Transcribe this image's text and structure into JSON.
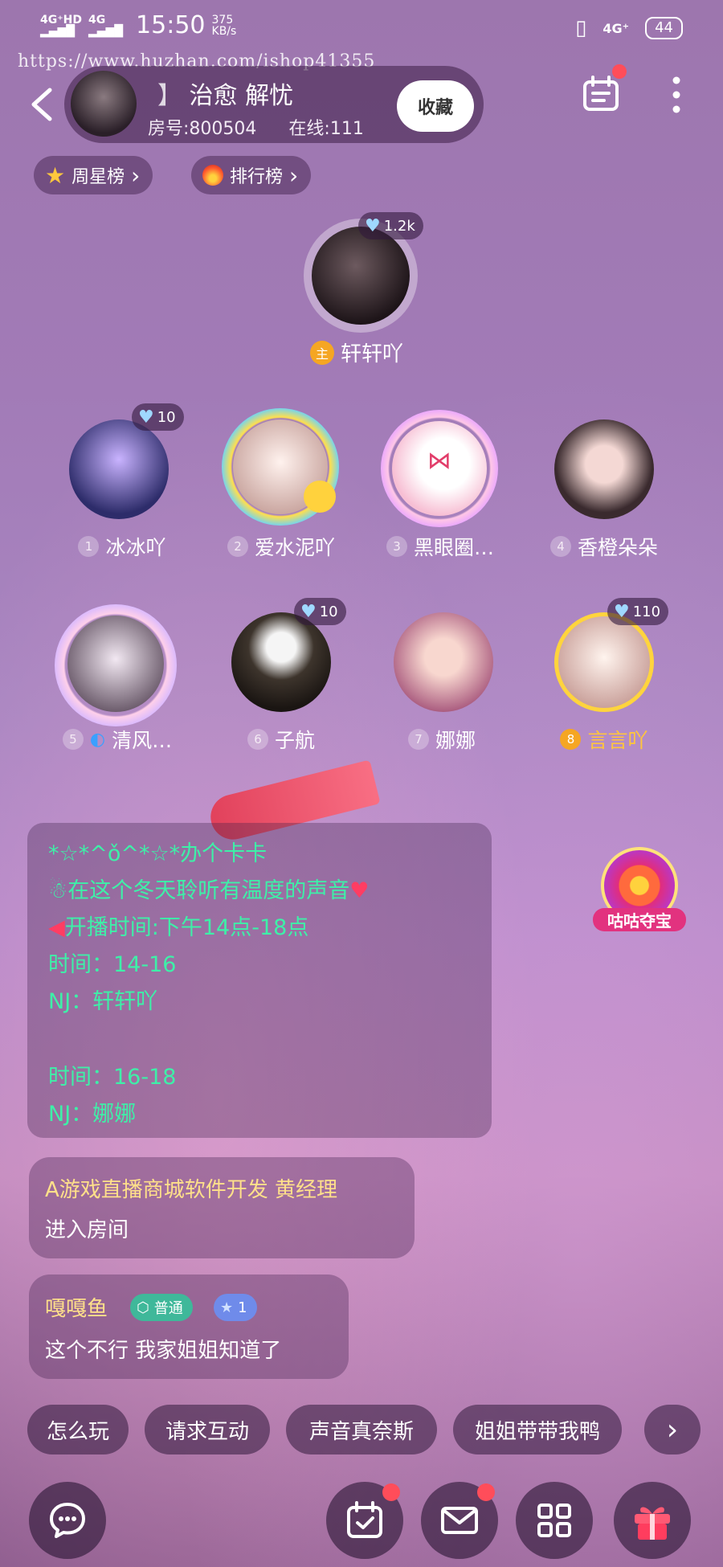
{
  "status_bar": {
    "net1": "4G⁺HD",
    "net2": "4G",
    "time": "15:50",
    "speed_value": "375",
    "speed_unit": "KB/s",
    "net_right": "4G⁺",
    "battery": "44"
  },
  "watermark": "https://www.huzhan.com/ishop41355",
  "room": {
    "title_mark": "】",
    "title": "治愈 解忧",
    "room_id_label": "房号:800504",
    "online_label": "在线:111",
    "favorite_label": "收藏"
  },
  "pills": {
    "week_star": "周星榜",
    "ranking": "排行榜",
    "chevron": "›"
  },
  "host": {
    "hearts": "1.2k",
    "tag": "主",
    "name": "轩轩吖"
  },
  "seats": [
    {
      "num": "1",
      "name": "冰冰吖",
      "hearts": "10",
      "avatar_color": "#2d2c6a"
    },
    {
      "num": "2",
      "name": "爱水泥吖",
      "hearts": "",
      "avatar_color": "#f0d2cc"
    },
    {
      "num": "3",
      "name": "黑眼圈…",
      "hearts": "",
      "avatar_color": "#f7bfd4"
    },
    {
      "num": "4",
      "name": "香橙朵朵",
      "hearts": "",
      "avatar_color": "#3a2a2e"
    },
    {
      "num": "5",
      "name": "清风…",
      "hearts": "",
      "avatar_color": "#d6c2d6"
    },
    {
      "num": "6",
      "name": "子航",
      "hearts": "10",
      "avatar_color": "#262020"
    },
    {
      "num": "7",
      "name": "娜娜",
      "hearts": "",
      "avatar_color": "#c98a9e"
    },
    {
      "num": "8",
      "name": "言言吖",
      "hearts": "110",
      "avatar_color": "#e9d6d2"
    }
  ],
  "notice": {
    "line1": "*☆*^ǒ^*☆*办个卡卡",
    "line2": "在这个冬天聆听有温度的声音",
    "line3": "开播时间:下午14点-18点",
    "line4": "时间：14-16",
    "line5": "NJ：轩轩吖",
    "line6": "时间：16-18",
    "line7": "NJ：娜娜"
  },
  "treasure_label": "咕咕夺宝",
  "chat": [
    {
      "name": "A游戏直播商城软件开发 黄经理",
      "text": "进入房间"
    },
    {
      "name": "嘎嘎鱼",
      "badge1": "普通",
      "badge2": "1",
      "text": "这个不行 我家姐姐知道了"
    }
  ],
  "quick_replies": [
    "怎么玩",
    "请求互动",
    "声音真奈斯",
    "姐姐带带我鸭"
  ],
  "quick_more": "›",
  "colors": {
    "notice_text": "#3ef0a8",
    "chat_name": "#ffe08a",
    "red_dot": "#ff4d5a",
    "gold": "#f5a623"
  }
}
